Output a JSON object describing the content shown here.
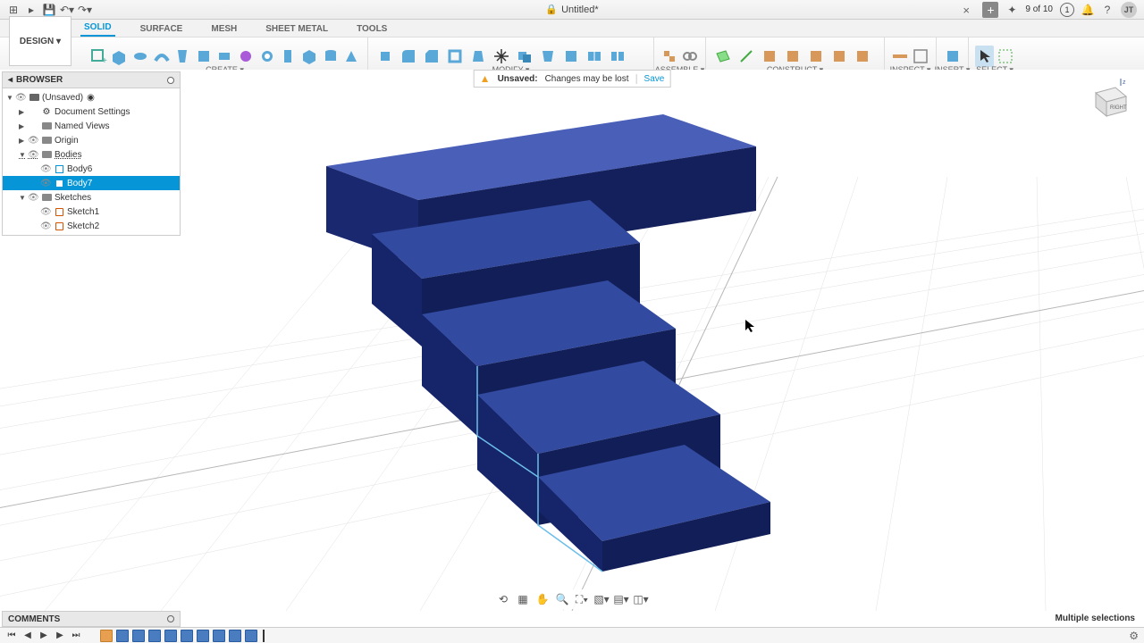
{
  "title": "Untitled*",
  "job_status": "9 of 10",
  "user_initials": "JT",
  "workspace_btn": "DESIGN ▾",
  "ribbon_tabs": [
    "SOLID",
    "SURFACE",
    "MESH",
    "SHEET METAL",
    "TOOLS"
  ],
  "active_ribbon": 0,
  "toolbar_groups": [
    "CREATE ▾",
    "MODIFY ▾",
    "ASSEMBLE ▾",
    "CONSTRUCT ▾",
    "INSPECT ▾",
    "INSERT ▾",
    "SELECT ▾"
  ],
  "browser_title": "BROWSER",
  "unsaved": {
    "label": "Unsaved:",
    "msg": "Changes may be lost",
    "save": "Save"
  },
  "tree": [
    {
      "d": 0,
      "exp": true,
      "eye": true,
      "icon": "comp",
      "label": "(Unsaved)",
      "radio": true
    },
    {
      "d": 1,
      "exp": false,
      "eye": false,
      "icon": "gear",
      "label": "Document Settings"
    },
    {
      "d": 1,
      "exp": false,
      "eye": false,
      "icon": "folder",
      "label": "Named Views"
    },
    {
      "d": 1,
      "exp": false,
      "eye": true,
      "icon": "folder",
      "label": "Origin"
    },
    {
      "d": 1,
      "exp": true,
      "eye": true,
      "icon": "folder",
      "label": "Bodies",
      "dim": true
    },
    {
      "d": 2,
      "exp": null,
      "eye": true,
      "icon": "body",
      "label": "Body6"
    },
    {
      "d": 2,
      "exp": null,
      "eye": true,
      "icon": "body",
      "label": "Body7",
      "sel": true
    },
    {
      "d": 1,
      "exp": true,
      "eye": true,
      "icon": "folder",
      "label": "Sketches"
    },
    {
      "d": 2,
      "exp": null,
      "eye": true,
      "icon": "sketch",
      "label": "Sketch1"
    },
    {
      "d": 2,
      "exp": null,
      "eye": true,
      "icon": "sketch",
      "label": "Sketch2"
    }
  ],
  "comments": "COMMENTS",
  "status": "Multiple selections",
  "viewcube": {
    "face": "RIGHT",
    "axis": "z"
  }
}
